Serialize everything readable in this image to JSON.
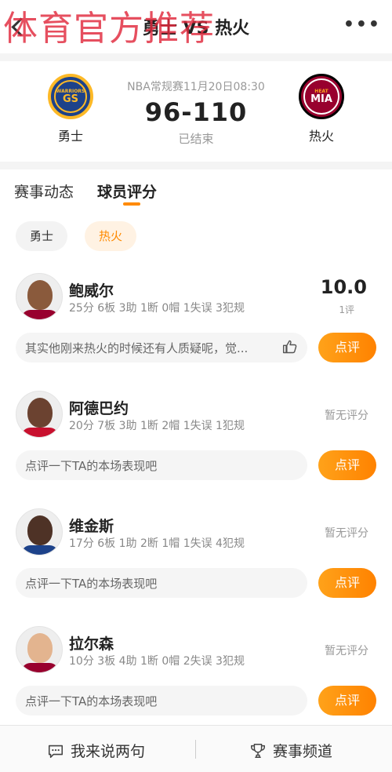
{
  "header": {
    "title": "勇士 VS 热火",
    "watermark": "体育官方推荐",
    "more": "•••"
  },
  "match": {
    "info": "NBA常规赛11月20日08:30",
    "score": "96-110",
    "status": "已结束",
    "home": {
      "name": "勇士",
      "logo_line1": "WARRIORS",
      "logo_line2": "GS"
    },
    "away": {
      "name": "热火",
      "logo_line1": "HEAT",
      "logo_line2": "MIA"
    }
  },
  "tabs": [
    {
      "label": "赛事动态",
      "active": false
    },
    {
      "label": "球员评分",
      "active": true
    }
  ],
  "team_filter": [
    {
      "label": "勇士",
      "active": false
    },
    {
      "label": "热火",
      "active": true
    }
  ],
  "players": [
    {
      "name": "鲍威尔",
      "stats": "25分 6板 3助 1断 0帽 1失误 3犯规",
      "rating": "10.0",
      "rating_count": "1评",
      "comment": "其实他刚来热火的时候还有人质疑呢，觉...",
      "review_label": "点评"
    },
    {
      "name": "阿德巴约",
      "stats": "20分 7板 3助 1断 2帽 1失误 1犯规",
      "rating_none": "暂无评分",
      "comment": "点评一下TA的本场表现吧",
      "review_label": "点评"
    },
    {
      "name": "维金斯",
      "stats": "17分 6板 1助 2断 1帽 1失误 4犯规",
      "rating_none": "暂无评分",
      "comment": "点评一下TA的本场表现吧",
      "review_label": "点评"
    },
    {
      "name": "拉尔森",
      "stats": "10分 3板 4助 1断 0帽 2失误 3犯规",
      "rating_none": "暂无评分",
      "comment": "点评一下TA的本场表现吧",
      "review_label": "点评"
    }
  ],
  "bottom": {
    "say_label": "我来说两句",
    "channel_label": "赛事频道"
  },
  "colors": {
    "accent": "#ff8a00",
    "watermark": "#e1283c"
  }
}
